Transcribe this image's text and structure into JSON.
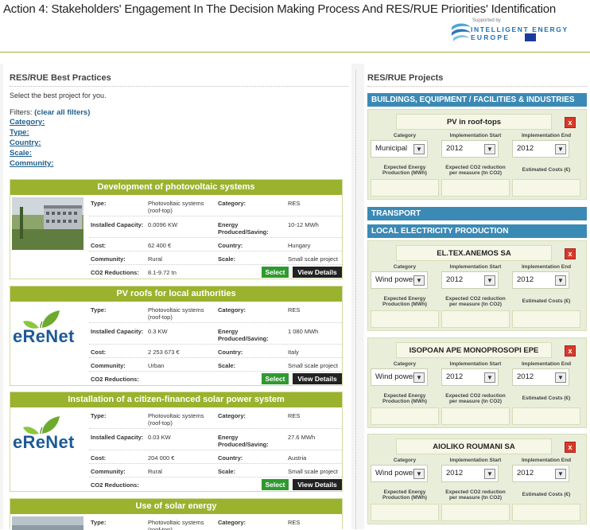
{
  "header": {
    "title": "Action 4: Stakeholders' Engagement In The Decision Making Process And RES/RUE Priorities' Identification",
    "logo": {
      "supported_by": "Supported by",
      "line1": "INTELLIGENT ENERGY",
      "line2": "EUROPE"
    }
  },
  "left": {
    "heading": "RES/RUE Best Practices",
    "intro": "Select the best project for you.",
    "filters_label": "Filters:",
    "clear_filters": "(clear all filters)",
    "filters": [
      "Category:",
      "Type:",
      "Country:",
      "Scale:",
      "Community:"
    ],
    "labels": {
      "type": "Type:",
      "category": "Category:",
      "installed": "Installed Capacity:",
      "energy": "Energy Produced/Saving:",
      "cost": "Cost:",
      "country": "Country:",
      "community": "Community:",
      "scale": "Scale:",
      "co2": "CO2 Reductions:",
      "select": "Select",
      "details": "View Details"
    },
    "practices": [
      {
        "title": "Development of photovoltaic systems",
        "image": "building-photo",
        "type": "Photovoltaic systems (roof-top)",
        "category": "RES",
        "installed": "0.0096 KW",
        "energy": "10-12 MWh",
        "cost": "62 400 €",
        "country": "Hungary",
        "community": "Rural",
        "scale": "Small scale project",
        "co2": "8.1-9.72 tn"
      },
      {
        "title": "PV roofs for local authorities",
        "image": "erenet-logo",
        "type": "Photovoltaic systems (roof-top)",
        "category": "RES",
        "installed": "0.3 KW",
        "energy": "1 080 MWh",
        "cost": "2 253 673 €",
        "country": "Italy",
        "community": "Urban",
        "scale": "Small scale project",
        "co2": ""
      },
      {
        "title": "Installation of a citizen-financed solar power system",
        "image": "erenet-logo",
        "type": "Photovoltaic systems (roof-top)",
        "category": "RES",
        "installed": "0.03 KW",
        "energy": "27.6 MWh",
        "cost": "204 000 €",
        "country": "Austria",
        "community": "Rural",
        "scale": "Small scale project",
        "co2": ""
      },
      {
        "title": "Use of solar energy",
        "image": "photo",
        "type": "Photovoltaic systems (roof-top)",
        "category": "RES"
      }
    ],
    "erenet_text": "eReNet"
  },
  "right": {
    "heading": "RES/RUE Projects",
    "field_labels": {
      "category": "Category",
      "start": "Implementation Start",
      "end": "Implementation End",
      "energy": "Expected Energy Production (MWh)",
      "co2": "Expected CO2 reduction per measure (tn CO2)",
      "costs": "Estimated Costs (€)"
    },
    "categories": [
      "BUILDINGS, EQUIPMENT / FACILITIES & INDUSTRIES",
      "TRANSPORT",
      "LOCAL ELECTRICITY PRODUCTION"
    ],
    "remove_label": "x",
    "projects": [
      {
        "name": "PV in roof-tops",
        "category": "Municipal",
        "start": "2012",
        "end": "2012"
      },
      {
        "name": "EL.TEX.ANEMOS SA",
        "category": "Wind power",
        "start": "2012",
        "end": "2012"
      },
      {
        "name": "ISOPOAN APE MONOPROSOPI EPE",
        "category": "Wind power",
        "start": "2012",
        "end": "2012"
      },
      {
        "name": "AIOLIKO ROUMANI SA",
        "category": "Wind power",
        "start": "2012",
        "end": "2012"
      }
    ]
  },
  "colors": {
    "green": "#9ab22e",
    "blue": "#3b8ab5",
    "select": "#2f9a2f",
    "remove": "#d73a2a"
  }
}
